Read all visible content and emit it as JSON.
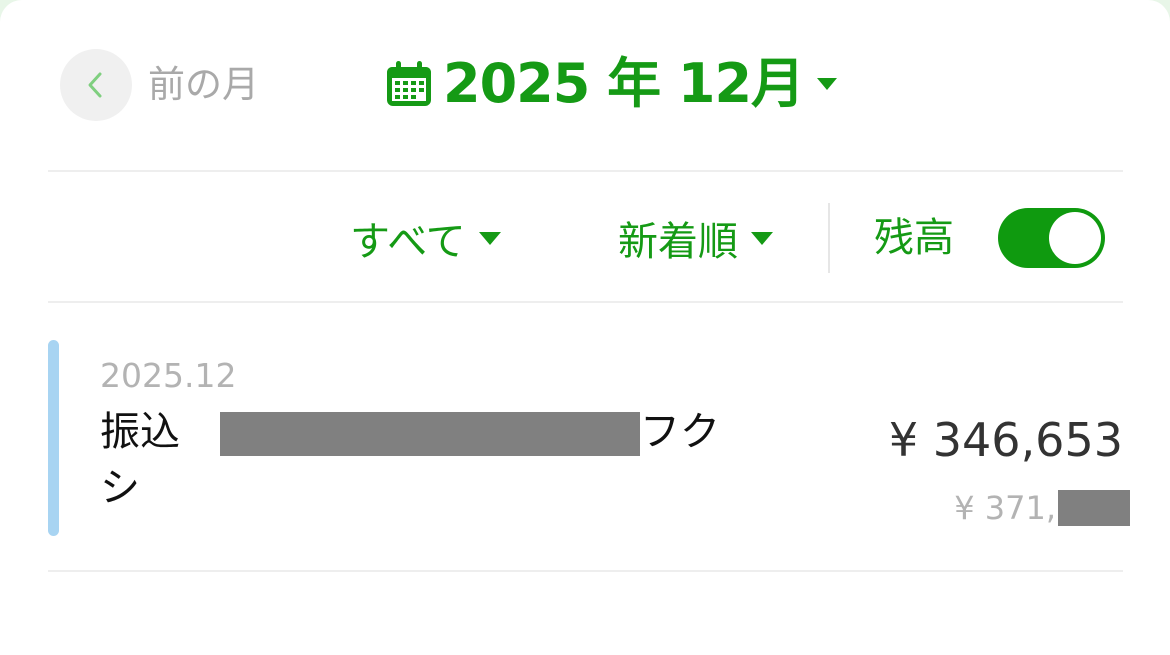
{
  "header": {
    "prev_label": "前の月",
    "month_title": "2025 年 12月"
  },
  "filters": {
    "type_label": "すべて",
    "sort_label": "新着順",
    "balance_label": "残高",
    "balance_toggle_on": true
  },
  "transactions": [
    {
      "date": "2025.12",
      "desc_prefix": "振込",
      "desc_suffix": "フク",
      "desc_line2": "シ",
      "amount": "¥ 346,653",
      "balance_prefix": "¥ 371,"
    }
  ],
  "colors": {
    "accent": "#159a15",
    "toggle_on": "#0f9a0f",
    "tx_marker": "#a8d4f2",
    "redaction": "#808080"
  },
  "icons": {
    "prev": "chevron-left-icon",
    "calendar": "calendar-icon",
    "caret": "caret-down-icon"
  }
}
